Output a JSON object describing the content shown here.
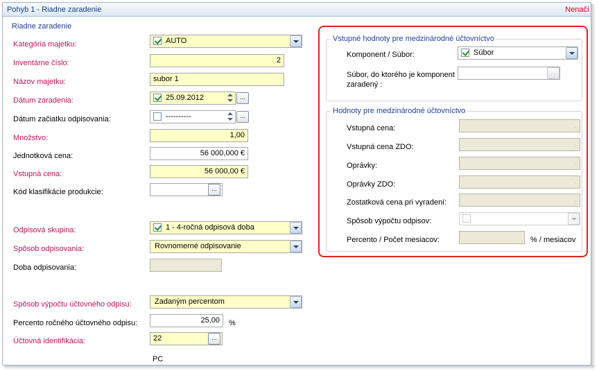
{
  "window": {
    "title": "Pohyb 1 - Riadne zaradenie",
    "right_label": "Nenačí"
  },
  "left": {
    "section_title": "Riadne zaradenie",
    "kategoria": {
      "label": "Kategória majetku:",
      "value": "AUTO"
    },
    "inventarne": {
      "label": "Inventárne číslo:",
      "value": "2"
    },
    "nazov": {
      "label": "Názov majetku:",
      "value": "subor 1"
    },
    "datum_zaradenia": {
      "label": "Dátum zaradenia:",
      "value": "25.09.2012",
      "button": "..."
    },
    "datum_odpis": {
      "label": "Dátum začiatku odpisovania:",
      "value": "----------",
      "button": "..."
    },
    "mnozstvo": {
      "label": "Množstvo:",
      "value": "1,00"
    },
    "jednotkova": {
      "label": "Jednotková cena:",
      "value": "56 000,000 €"
    },
    "vstupna": {
      "label": "Vstupná cena:",
      "value": "56 000,00 €"
    },
    "kod": {
      "label": "Kód klasifikácie produkcie:",
      "value": "",
      "button": "..."
    },
    "odpisova_skupina": {
      "label": "Odpisová skupina:",
      "value": "1 - 4-ročná odpisová doba"
    },
    "sposob_odpisovania": {
      "label": "Spôsob odpisovania:",
      "value": "Rovnomerné odpisovanie"
    },
    "doba": {
      "label": "Doba odpisovania:",
      "value": ""
    },
    "sposob_uctovneho": {
      "label": "Spôsob výpočtu účtovného odpisu:",
      "value": "Zadaným percentom"
    },
    "percento": {
      "label": "Percento ročného účtovného odpisu:",
      "value": "25,00",
      "unit": "%"
    },
    "uctovna": {
      "label": "Účtovná identifikácia:",
      "value": "22",
      "button": "..."
    },
    "bottom_text": "PC"
  },
  "right": {
    "group1": {
      "title": "Vstupné hodnoty pre medzinárodné účtovníctvo",
      "komponent": {
        "label": "Komponent / Súbor:",
        "value": "Súbor"
      },
      "subor": {
        "label": "Súbor, do ktorého je komponent zaradený :",
        "value": "",
        "button": "..."
      }
    },
    "group2": {
      "title": "Hodnoty pre medzinárodné účtovníctvo",
      "vstupna": {
        "label": "Vstupná cena:"
      },
      "vstupna_zdo": {
        "label": "Vstupná cena ZDO:"
      },
      "opravky": {
        "label": "Oprávky:"
      },
      "opravky_zdo": {
        "label": "Oprávky ZDO:"
      },
      "zostatkova": {
        "label": "Zostatková cena pri vyradení:"
      },
      "sposob": {
        "label": "Spôsob výpočtu odpisov:"
      },
      "percento": {
        "label": "Percento / Počet mesiacov:",
        "unit": "% / mesiacov"
      }
    }
  },
  "colors": {
    "required": "#c0135a",
    "section": "#1f3f9a",
    "highlight": "#e2231a",
    "field_yellow": "#ffffc8"
  }
}
